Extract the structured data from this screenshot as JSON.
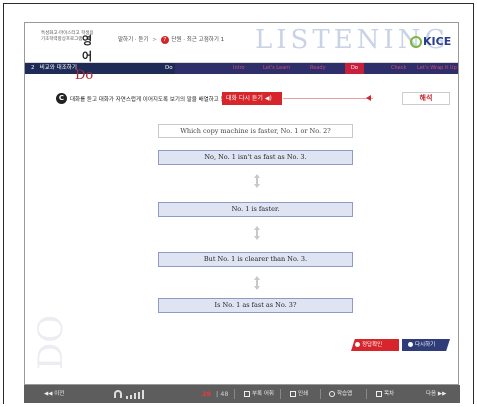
{
  "header": {
    "brand_line1": "특성화고·마이스터고 학생용",
    "brand_line2": "기초학력향상프로그램",
    "subject": "영어",
    "breadcrumb_section": "말하기 · 듣기",
    "breadcrumb_unit_num": "7",
    "breadcrumb_unit": "단원 · 최근 고점하기 1",
    "watermark": "LISTENING",
    "logo": "KICE"
  },
  "navbar": {
    "lesson_num": "2",
    "lesson_title": "비교와 대조하기",
    "current": "Do",
    "tabs": [
      {
        "label": "Intro"
      },
      {
        "label": "Let's Learn"
      },
      {
        "label": "Ready"
      },
      {
        "label": "Do"
      },
      {
        "label": "Check"
      },
      {
        "label": "Let's Wrap It Up"
      }
    ]
  },
  "activity": {
    "section_label": "Do",
    "badge_letter": "C",
    "instruction": "대화를 듣고 대화가 자연스럽게 이어지도록 보기의 말을 배열하고 말해 봅시다.",
    "listen_button": "대화 다시 듣기 ◀)",
    "answer_button": "해석",
    "side_watermark": "DO",
    "question": "Which copy machine is faster, No. 1 or No. 2?",
    "sentences": [
      "No, No. 1 isn't as fast as No. 3.",
      "No. 1 is faster.",
      "But No. 1 is clearer than No. 3.",
      "Is No. 1 as fast as No. 3?"
    ],
    "check_button": "정답확인",
    "retry_button": "다시하기"
  },
  "footer": {
    "prev": "◀◀ 이전",
    "page_current": "28",
    "page_total": "| 48",
    "vocab": "부록 어휘",
    "print": "인쇄",
    "study": "학습맵",
    "toc": "목차",
    "next": "다음 ▶▶"
  }
}
